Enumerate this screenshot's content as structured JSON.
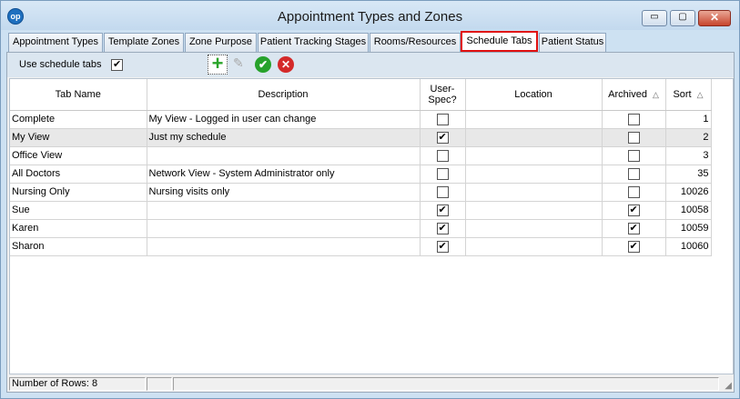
{
  "window": {
    "title": "Appointment Types and Zones",
    "app_icon_label": "op",
    "minimize_glyph": "▭",
    "maximize_glyph": "▢",
    "close_glyph": "✕"
  },
  "tabs": [
    {
      "label": "Appointment Types"
    },
    {
      "label": "Template Zones"
    },
    {
      "label": "Zone Purpose"
    },
    {
      "label": "Patient Tracking Stages"
    },
    {
      "label": "Rooms/Resources"
    },
    {
      "label": "Schedule Tabs",
      "active": true
    },
    {
      "label": "Patient Status"
    }
  ],
  "toolbar": {
    "use_schedule_tabs_label": "Use schedule tabs",
    "use_schedule_tabs_checked": true,
    "add_icon": "plus-icon",
    "edit_icon": "pencil-icon",
    "ok_icon": "checkmark-icon",
    "cancel_icon": "x-circle-icon"
  },
  "grid": {
    "columns": {
      "tab_name": "Tab Name",
      "description": "Description",
      "user_spec": "User-Spec?",
      "location": "Location",
      "archived": "Archived",
      "sort": "Sort"
    },
    "sort_indicator": "△",
    "rows": [
      {
        "tab_name": "Complete",
        "description": "My View - Logged in user can change",
        "user_spec": false,
        "location": "",
        "archived": false,
        "sort": "1"
      },
      {
        "tab_name": "My View",
        "description": "Just my schedule",
        "user_spec": true,
        "location": "",
        "archived": false,
        "sort": "2"
      },
      {
        "tab_name": "Office View",
        "description": "",
        "user_spec": false,
        "location": "",
        "archived": false,
        "sort": "3"
      },
      {
        "tab_name": "All Doctors",
        "description": "Network View - System Administrator only",
        "user_spec": false,
        "location": "",
        "archived": false,
        "sort": "35"
      },
      {
        "tab_name": "Nursing Only",
        "description": "Nursing visits only",
        "user_spec": false,
        "location": "",
        "archived": false,
        "sort": "10026"
      },
      {
        "tab_name": "Sue",
        "description": "",
        "user_spec": true,
        "location": "",
        "archived": true,
        "sort": "10058"
      },
      {
        "tab_name": "Karen",
        "description": "",
        "user_spec": true,
        "location": "",
        "archived": true,
        "sort": "10059"
      },
      {
        "tab_name": "Sharon",
        "description": "",
        "user_spec": true,
        "location": "",
        "archived": true,
        "sort": "10060"
      }
    ],
    "selected_row": 1
  },
  "status": {
    "row_count": "Number of Rows: 8"
  },
  "colors": {
    "active_tab_border": "#e01010",
    "toolbar_bg": "#dbe6f0",
    "window_bg": "#cde1f2"
  }
}
